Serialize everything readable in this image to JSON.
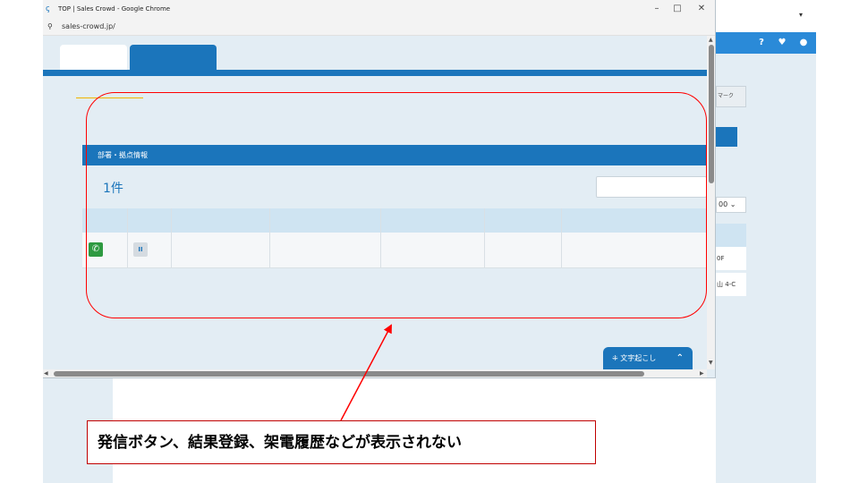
{
  "window": {
    "title": "TOP | Sales Crowd - Google Chrome",
    "url": "sales-crowd.jp/",
    "controls": {
      "minimize": "–",
      "maximize": "□",
      "close": "✕"
    }
  },
  "popup": {
    "section_title": "部署・拠点情報",
    "count": "1件",
    "call_button_glyph": "✆",
    "pause_button_glyph": "II",
    "transcribe_label": "文字起こし",
    "transcribe_chevron": "⌃"
  },
  "background_app": {
    "tab_partial": "マーク",
    "select_partial": "00 ⌄",
    "row1_partial": "0F",
    "row2_partial": "山 4-C",
    "caret": "▾"
  },
  "annotation": {
    "callout_text": "発信ボタン、結果登録、架電履歴などが表示されない",
    "highlight_color": "#ff0000"
  },
  "colors": {
    "brand_blue": "#1b75bb",
    "call_green": "#2e9a41"
  }
}
